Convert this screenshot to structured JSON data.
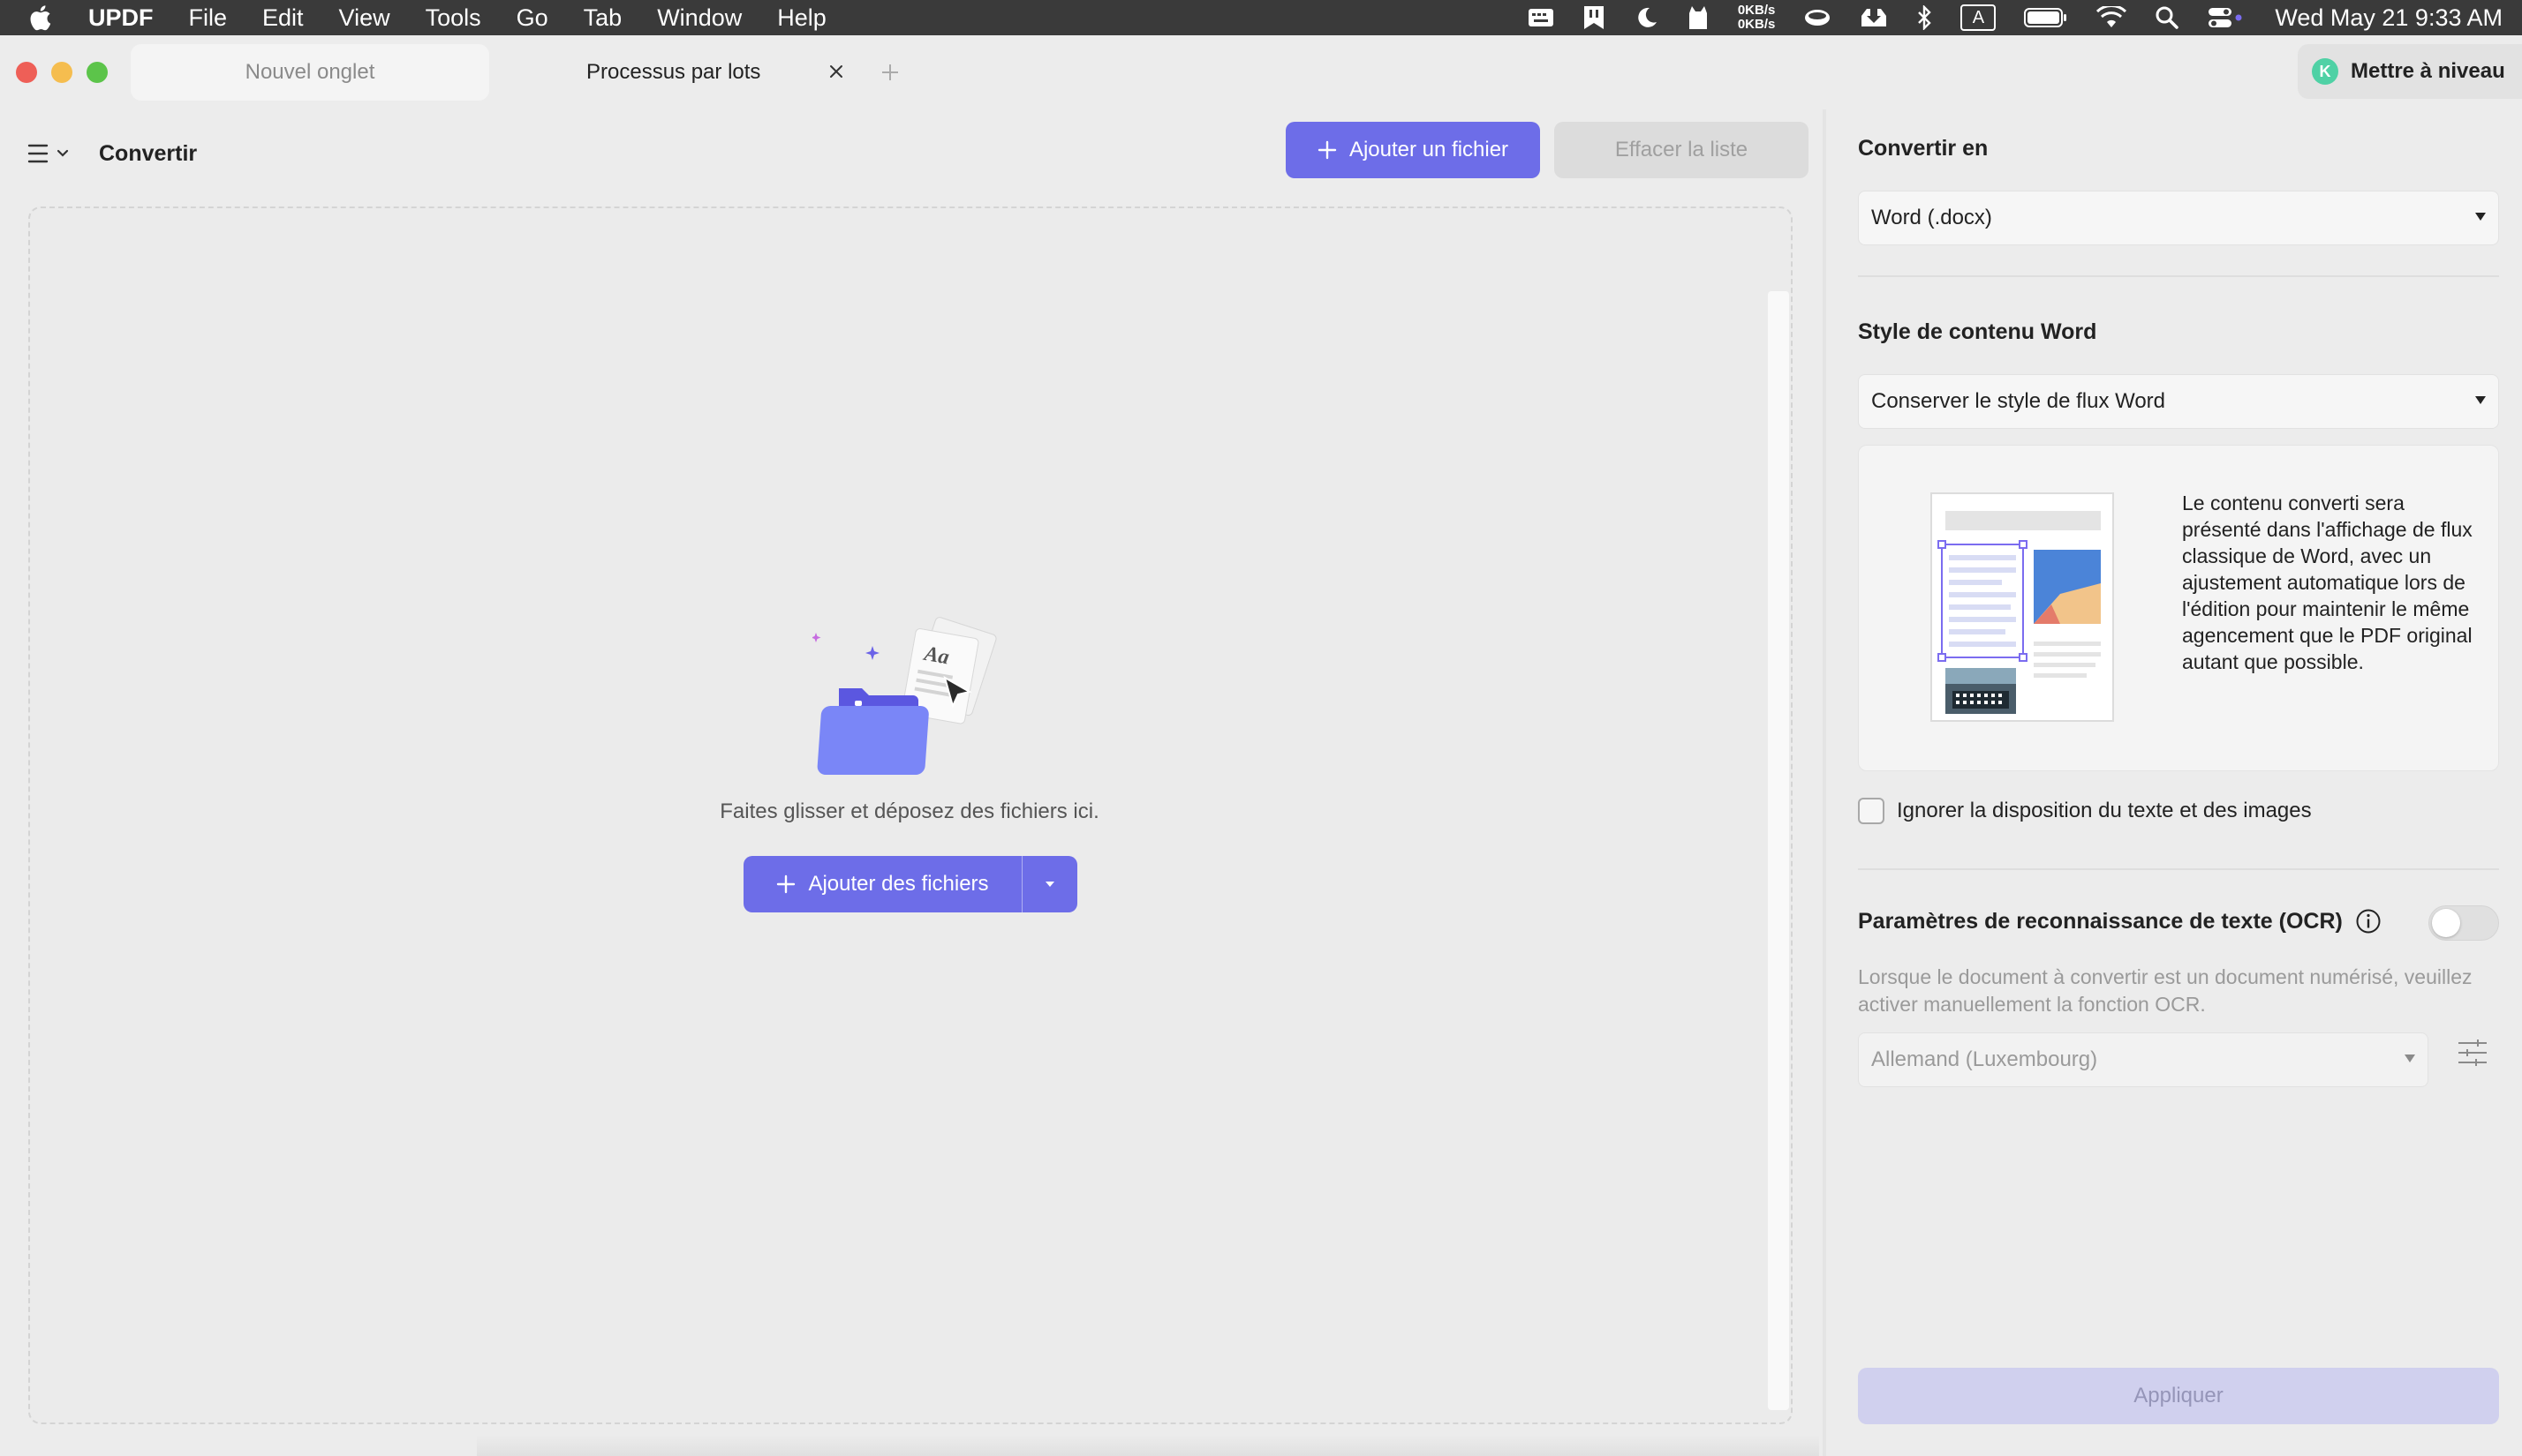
{
  "menubar": {
    "app_name": "UPDF",
    "items": [
      "File",
      "Edit",
      "View",
      "Tools",
      "Go",
      "Tab",
      "Window",
      "Help"
    ],
    "net_up": "0KB/s",
    "net_down": "0KB/s",
    "input_source": "A",
    "clock": "Wed May 21  9:33 AM"
  },
  "tabs": {
    "tab1": "Nouvel onglet",
    "tab2": "Processus par lots"
  },
  "upgrade": {
    "avatar_letter": "K",
    "label": "Mettre à niveau"
  },
  "left": {
    "title": "Convertir",
    "add_file": "Ajouter un fichier",
    "clear_list": "Effacer la liste",
    "drop_text": "Faites glisser et déposez des fichiers ici.",
    "add_files": "Ajouter des fichiers"
  },
  "right": {
    "convert_to_label": "Convertir en",
    "convert_to_value": "Word (.docx)",
    "word_style_label": "Style de contenu Word",
    "word_style_value": "Conserver le style de flux Word",
    "preview_description": "Le contenu converti sera présenté dans l'affichage de flux classique de Word, avec un ajustement automatique lors de l'édition pour maintenir le même agencement que le PDF original autant que possible.",
    "ignore_layout": "Ignorer la disposition du texte et des images",
    "ocr_label": "Paramètres de reconnaissance de texte (OCR)",
    "ocr_note": "Lorsque le document à convertir est un document numérisé, veuillez activer manuellement la fonction OCR.",
    "ocr_language": "Allemand (Luxembourg)",
    "apply": "Appliquer"
  },
  "colors": {
    "accent": "#6d6de8",
    "apply_disabled": "#d0d0ee"
  }
}
